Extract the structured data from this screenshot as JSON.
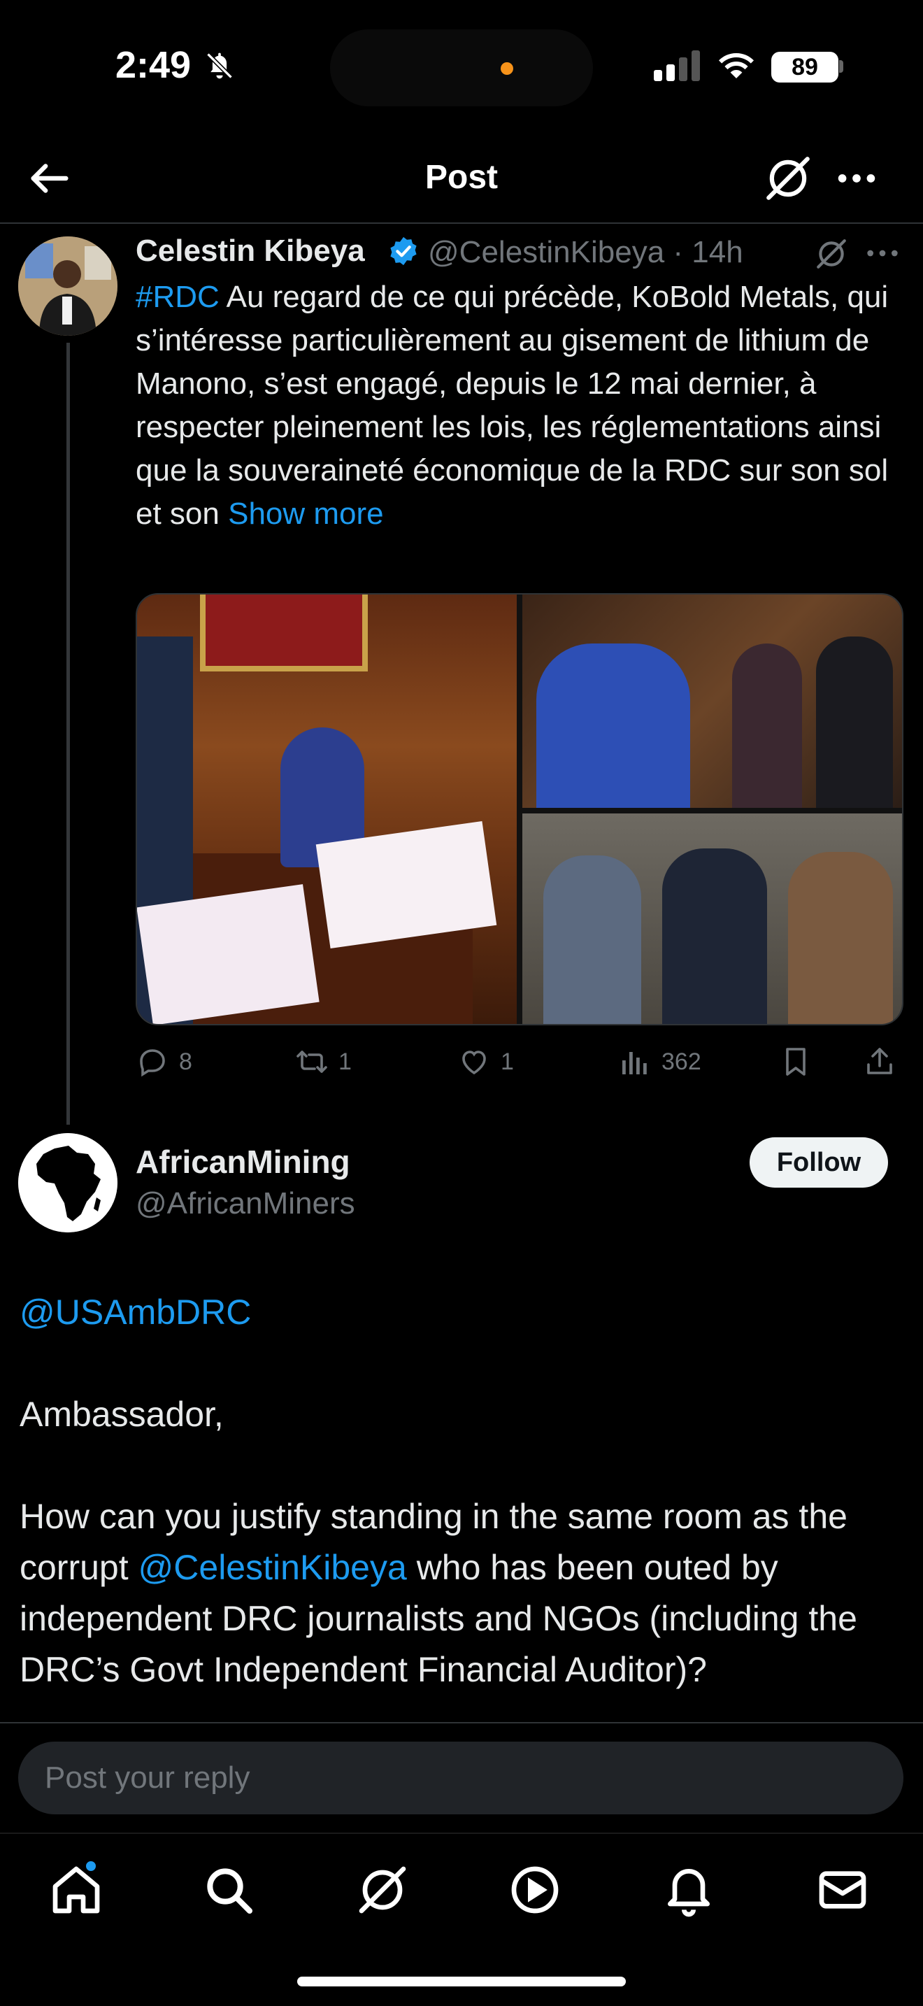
{
  "status_bar": {
    "time": "2:49",
    "battery": "89"
  },
  "header": {
    "title": "Post"
  },
  "parent_tweet": {
    "name": "Celestin Kibeya",
    "handle_time": "@CelestinKibeya · 14h",
    "hashtag": "#RDC",
    "text": " Au regard de ce qui précède, KoBold Metals, qui s’intéresse particulièrement au gisement de lithium de Manono, s’est engagé, depuis le 12 mai dernier, à respecter pleinement les lois, les réglementations ainsi que la souveraineté économique de la RDC sur son sol et son ",
    "show_more": "Show more",
    "stats": {
      "replies": "8",
      "retweets": "1",
      "likes": "1",
      "views": "362"
    }
  },
  "reply_tweet": {
    "name": "AfricanMining",
    "handle": "@AfricanMiners",
    "follow_label": "Follow",
    "mention1": "@USAmbDRC",
    "line2": "Ambassador,",
    "line3a": "How can you justify standing in the same room as the corrupt ",
    "mention2": "@CelestinKibeya",
    "line3b": " who has been outed by independent DRC journalists and NGOs (including the DRC’s Govt Independent Financial Auditor)?"
  },
  "reply_bar": {
    "placeholder": "Post your reply"
  },
  "colors": {
    "accent": "#1d9bf0",
    "background": "#000000",
    "muted": "#71767b"
  }
}
